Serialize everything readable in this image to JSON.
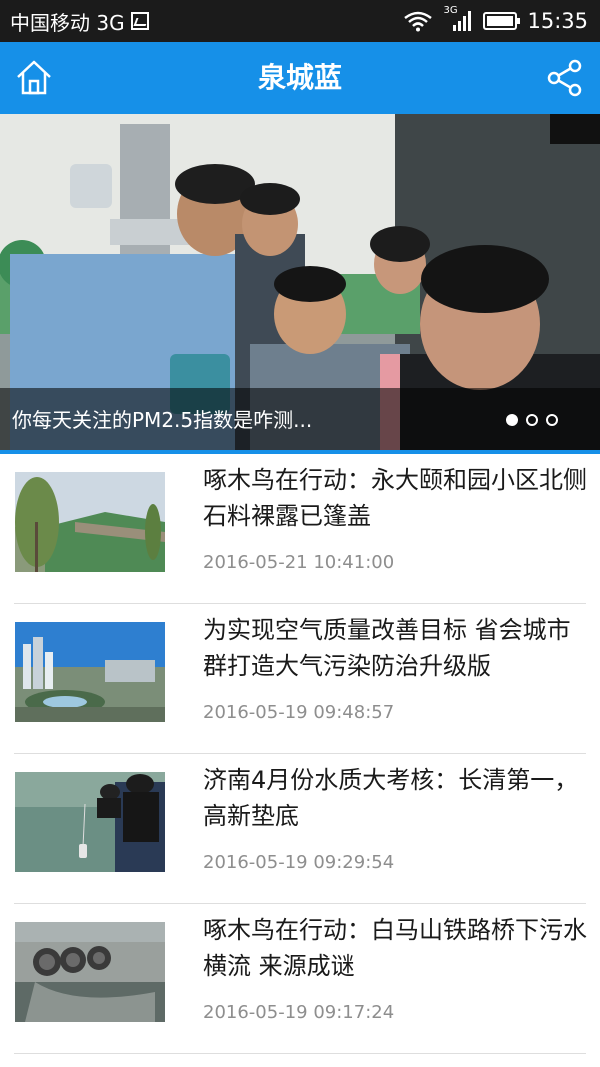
{
  "status_bar": {
    "carrier": "中国移动 3G",
    "net_label": "3G",
    "time": "15:35"
  },
  "header": {
    "title": "泉城蓝"
  },
  "carousel": {
    "caption": "你每天关注的PM2.5指数是咋测...",
    "slide_count": 3,
    "active_index": 0
  },
  "news": [
    {
      "title": "啄木鸟在行动：永大颐和园小区北侧石料裸露已篷盖",
      "time": "2016-05-21 10:41:00"
    },
    {
      "title": "为实现空气质量改善目标 省会城市群打造大气污染防治升级版",
      "time": "2016-05-19 09:48:57"
    },
    {
      "title": "济南4月份水质大考核：长清第一，高新垫底",
      "time": "2016-05-19 09:29:54"
    },
    {
      "title": "啄木鸟在行动：白马山铁路桥下污水横流 来源成谜",
      "time": "2016-05-19 09:17:24"
    }
  ],
  "colors": {
    "accent": "#1690e8",
    "status_bar": "#1b1b1b"
  }
}
